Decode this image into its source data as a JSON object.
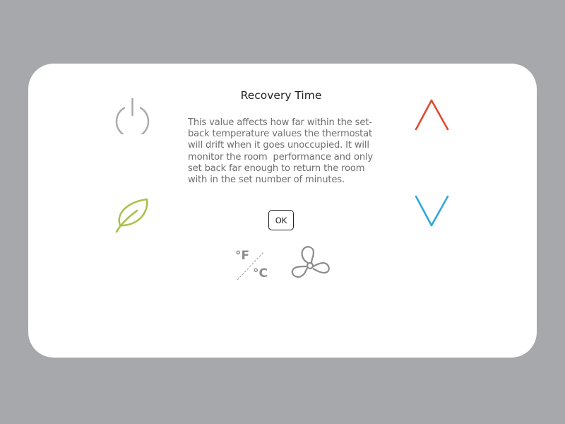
{
  "dialog": {
    "title": "Recovery Time",
    "body_lines": [
      "This value affects how far within the set-",
      "back temperature values the thermostat",
      "will drift when it goes unoccupied. It will",
      "monitor the room  performance and only",
      "set back far enough to return the room",
      "with in the set number of minutes."
    ],
    "ok_label": "OK"
  },
  "units": {
    "fahrenheit_label": "°F",
    "celsius_label": "°C"
  },
  "icons": {
    "power": "power-icon",
    "eco": "leaf-icon",
    "increase": "chevron-up-icon",
    "decrease": "chevron-down-icon",
    "units": "temperature-units-icon",
    "fan": "fan-icon"
  },
  "colors": {
    "background": "#a7a8ac",
    "panel": "#ffffff",
    "power_icon": "#a9a9a9",
    "leaf_icon": "#a6c34a",
    "up_arrow": "#e04a2f",
    "down_arrow": "#2fa7d9",
    "text": "#222222",
    "body_text": "#6e6e6e"
  }
}
